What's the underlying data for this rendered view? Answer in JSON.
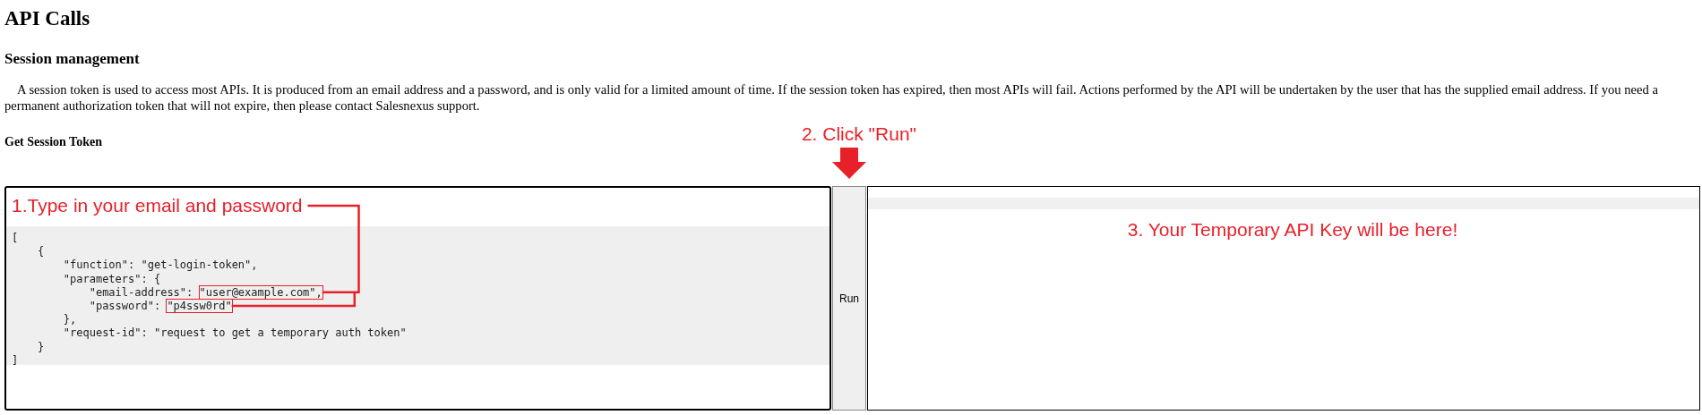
{
  "page": {
    "title": "API Calls",
    "section": "Session management",
    "paragraph": "A session token is used to access most APIs. It is produced from an email address and a password, and is only valid for a limited amount of time. If the session token has expired, then most APIs will fail. Actions performed by the API will be undertaken by the user that has the supplied email address. If you need a permanent authorization token that will not expire, then please contact Salesnexus support.",
    "subsection": "Get Session Token"
  },
  "request_editor": {
    "annotation": "1.Type in your email and password",
    "code_lines": [
      [
        {
          "text": "["
        }
      ],
      [
        {
          "text": "    {"
        }
      ],
      [
        {
          "text": "        \"function\": \"get-login-token\","
        }
      ],
      [
        {
          "text": "        \"parameters\": {"
        }
      ],
      [
        {
          "text": "            \"email-address\": "
        },
        {
          "text": "\"user@example.com\",",
          "highlighted": true
        }
      ],
      [
        {
          "text": "            \"password\": "
        },
        {
          "text": "\"p4ssw0rd\"",
          "highlighted": true
        }
      ],
      [
        {
          "text": "        },"
        }
      ],
      [
        {
          "text": "        \"request-id\": \"request to get a temporary auth token\""
        }
      ],
      [
        {
          "text": "    }"
        }
      ],
      [
        {
          "text": "]"
        }
      ]
    ]
  },
  "run_button": {
    "label": "Run",
    "annotation": "2. Click \"Run\""
  },
  "output_panel": {
    "annotation": "3. Your Temporary API Key will be here!"
  }
}
